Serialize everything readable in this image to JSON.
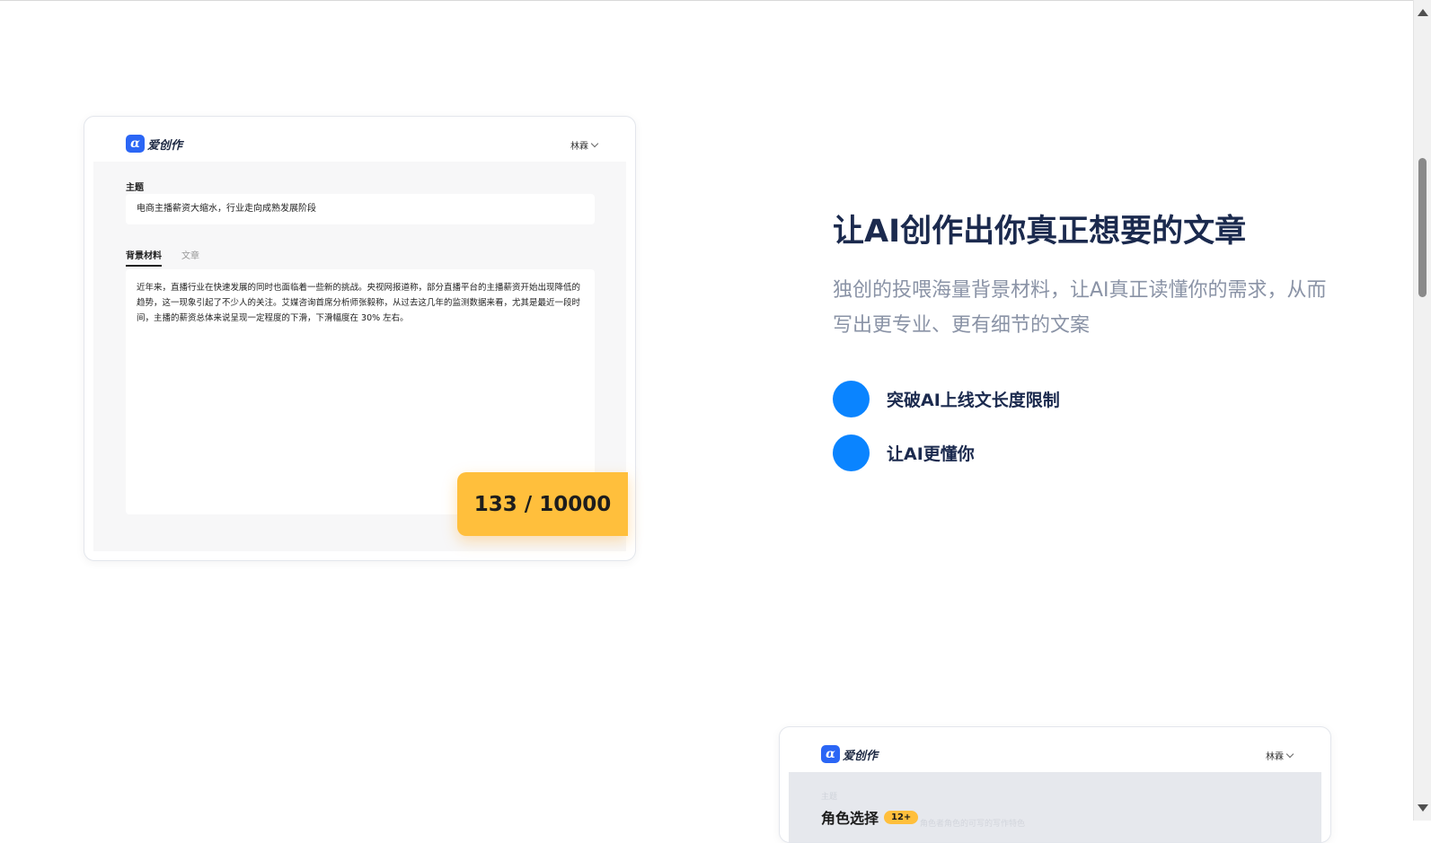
{
  "app": {
    "logo_text": "爱创作",
    "logo_mark": "α",
    "user_name": "林霖"
  },
  "editor": {
    "topic_label": "主题",
    "topic_value": "电商主播薪资大缩水，行业走向成熟发展阶段",
    "tabs": [
      {
        "label": "背景材料",
        "active": true
      },
      {
        "label": "文章",
        "active": false
      }
    ],
    "material_text": "近年来，直播行业在快速发展的同时也面临着一些新的挑战。央视网报道称，部分直播平台的主播薪资开始出现降低的趋势，这一现象引起了不少人的关注。艾媒咨询首席分析师张毅称，从过去这几年的监测数据来看，尤其是最近一段时间，主播的薪资总体来说呈现一定程度的下滑，下滑幅度在 30% 左右。",
    "counter": "133 / 10000"
  },
  "feature": {
    "title": "让AI创作出你真正想要的文章",
    "description": "独创的投喂海量背景材料，让AI真正读懂你的需求，从而写出更专业、更有细节的文案",
    "bullets": [
      "突破AI上线文长度限制",
      "让AI更懂你"
    ],
    "accent_color": "#0a84ff"
  },
  "preview2": {
    "faint_label": "主题",
    "role_title": "角色选择",
    "role_badge": "12+",
    "faint_hint": "角色者角色的可写的写作特色"
  },
  "colors": {
    "brand_blue": "#2b66f5",
    "counter_yellow": "#ffbf3c",
    "title_navy": "#1b2a4e"
  }
}
